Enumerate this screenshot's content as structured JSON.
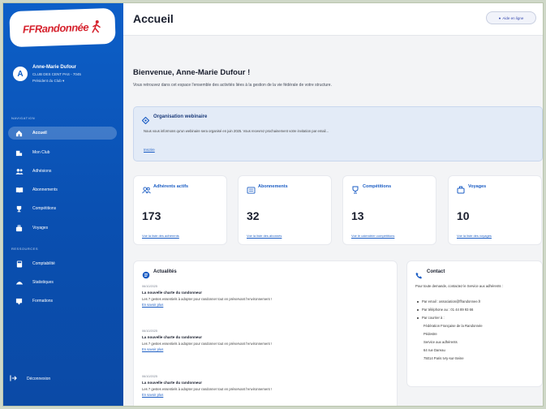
{
  "sidebar": {
    "logo": "FFRandonnée",
    "user": {
      "initial": "A",
      "name": "Anne-Marie Dufour",
      "org": "CLUB DES CENT PAS - 7045",
      "role": "Président du Club"
    },
    "section_navigation": "NAVIGATION",
    "section_resources": "RESSOURCES",
    "nav": [
      {
        "label": "Accueil",
        "icon": "home-icon",
        "active": true
      },
      {
        "label": "Mon Club",
        "icon": "building-icon",
        "active": false
      },
      {
        "label": "Adhésions",
        "icon": "users-icon",
        "active": false
      },
      {
        "label": "Abonnements",
        "icon": "book-icon",
        "active": false
      },
      {
        "label": "Compétitions",
        "icon": "trophy-icon",
        "active": false
      },
      {
        "label": "Voyages",
        "icon": "suitcase-icon",
        "active": false
      }
    ],
    "resources": [
      {
        "label": "Comptabilité",
        "icon": "calculator-icon"
      },
      {
        "label": "Statistiques",
        "icon": "chart-icon"
      },
      {
        "label": "Formations",
        "icon": "graduation-icon"
      }
    ],
    "logout": "Déconnexion"
  },
  "header": {
    "title": "Accueil",
    "button": "Aide en ligne"
  },
  "main": {
    "welcome": "Bienvenue, Anne-Marie Dufour !",
    "intro": "Vous retrouvez dans cet espace l'ensemble des activités liées à la gestion de la vie fédérale de votre structure.",
    "webinar": {
      "title": "Organisation webinaire",
      "text": "Nous vous informons qu'un webinaire sera organisé en juin 2025. Vous recevrez prochainement votre invitation par email...",
      "link": "Inscrire"
    },
    "stats": [
      {
        "title": "Adhérents actifs",
        "icon": "users-icon",
        "value": "173",
        "link": "Voir la liste des adhérents"
      },
      {
        "title": "Abonnements",
        "icon": "book-icon",
        "value": "32",
        "link": "Voir la liste des abonnés"
      },
      {
        "title": "Compétitions",
        "icon": "trophy-icon",
        "value": "13",
        "link": "Voir le calendrier compétitions"
      },
      {
        "title": "Voyages",
        "icon": "suitcase-icon",
        "value": "10",
        "link": "Voir la liste des voyages"
      }
    ],
    "news": {
      "title": "Actualités",
      "items": [
        {
          "date": "06/10/2025",
          "head": "La nouvelle charte du randonneur",
          "body": "Les 7 gestes essentiels à adopter pour randonner tout en préservant l'environnement !",
          "link": "En savoir plus"
        },
        {
          "date": "06/10/2025",
          "head": "La nouvelle charte du randonneur",
          "body": "Les 7 gestes essentiels à adopter pour randonner tout en préservant l'environnement !",
          "link": "En savoir plus"
        },
        {
          "date": "06/10/2025",
          "head": "La nouvelle charte du randonneur",
          "body": "Les 7 gestes essentiels à adopter pour randonner tout en préservant l'environnement !",
          "link": "En savoir plus"
        }
      ]
    },
    "contact": {
      "title": "Contact",
      "intro": "Pour toute demande, contactez le Service aux adhérents :",
      "email": "Par email : association@ffrandonnee.fr",
      "phone": "Par téléphone au : 01 44 89 93 66",
      "mail": "Par courrier à :",
      "address": [
        "Fédération Française de la Randonnée",
        "Pédestre",
        "Service aux adhérents",
        "64 rue Dareau",
        "75014 Paris Ivry-sur-Seine"
      ]
    }
  }
}
